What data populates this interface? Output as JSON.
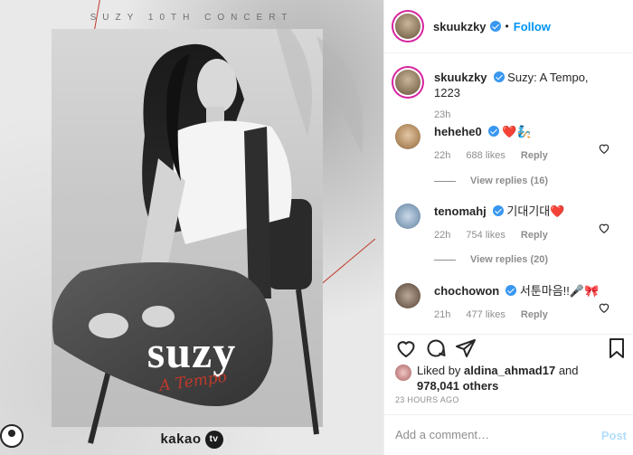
{
  "poster": {
    "top_text": "SUZY 10TH CONCERT",
    "title": "suzy",
    "subtitle": "A Tempo",
    "brand": "kakao",
    "brand_badge": "tv"
  },
  "header": {
    "username": "skuukzky",
    "separator": "•",
    "follow_label": "Follow"
  },
  "caption": {
    "username": "skuukzky",
    "text": "Suzy: A Tempo, 1223",
    "time": "23h"
  },
  "comments": [
    {
      "username": "hehehe0",
      "text": "❤️🧞",
      "time": "22h",
      "likes": "688 likes",
      "reply": "Reply",
      "view_replies": "View replies (16)"
    },
    {
      "username": "tenomahj",
      "text": "기대기대❤️",
      "time": "22h",
      "likes": "754 likes",
      "reply": "Reply",
      "view_replies": "View replies (20)"
    },
    {
      "username": "chochowon",
      "text": "서툰마음!!🎤🎀",
      "time": "21h",
      "likes": "477 likes",
      "reply": "Reply"
    }
  ],
  "likes": {
    "prefix": "Liked by",
    "user": "aldina_ahmad17",
    "and": "and",
    "others": "978,041 others"
  },
  "timestamp": "23 HOURS AGO",
  "add_comment": {
    "placeholder": "Add a comment…",
    "post_label": "Post"
  },
  "colors": {
    "accent": "#0095f6",
    "verified": "#3897f0",
    "like_red": "#ed4956",
    "poster_red": "#c0392b"
  },
  "icons": [
    "heart-icon",
    "comment-icon",
    "share-icon",
    "bookmark-icon",
    "verified-icon"
  ]
}
